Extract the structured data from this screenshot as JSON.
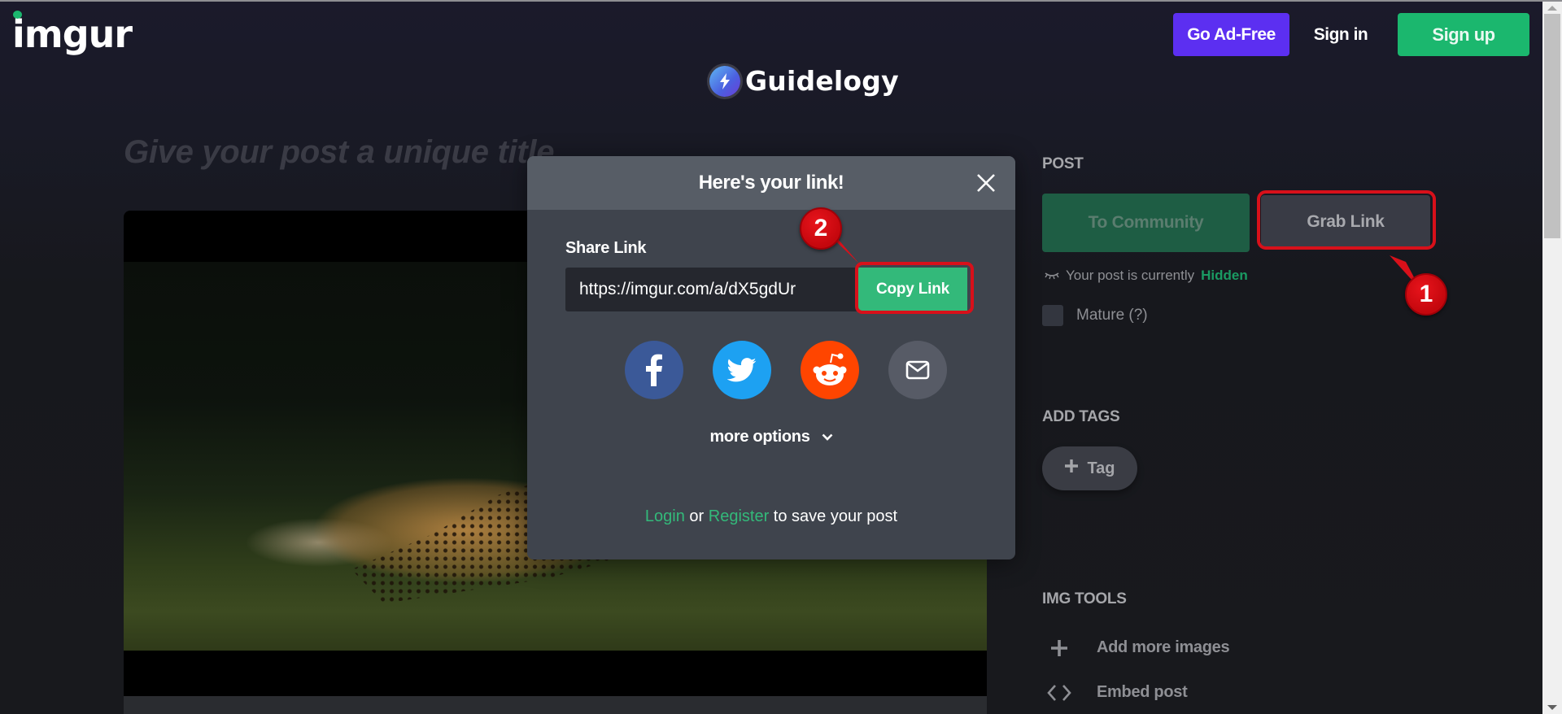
{
  "header": {
    "logo": "imgur",
    "go_ad_free": "Go Ad-Free",
    "sign_in": "Sign in",
    "sign_up": "Sign up",
    "watermark": "Guidelogy"
  },
  "post": {
    "title_placeholder": "Give your post a unique title",
    "title_value": ""
  },
  "modal": {
    "title": "Here's your link!",
    "share_label": "Share Link",
    "share_url": "https://imgur.com/a/dX5gdUr",
    "copy_button": "Copy Link",
    "share_targets": [
      {
        "name": "facebook",
        "icon": "facebook-icon",
        "color": "#3b5998"
      },
      {
        "name": "twitter",
        "icon": "twitter-icon",
        "color": "#1da1f2"
      },
      {
        "name": "reddit",
        "icon": "reddit-icon",
        "color": "#ff4500"
      },
      {
        "name": "email",
        "icon": "mail-icon",
        "color": "#575b66"
      }
    ],
    "more_options": "more options",
    "login_link": "Login",
    "or_text": "or",
    "register_link": "Register",
    "save_suffix": "to save your post"
  },
  "sidebar": {
    "post_label": "POST",
    "to_community": "To Community",
    "grab_link": "Grab Link",
    "visibility_prefix": "Your post is currently",
    "visibility_state": "Hidden",
    "mature_label": "Mature (?)",
    "mature_checked": false,
    "add_tags_label": "ADD TAGS",
    "tag_button": "Tag",
    "img_tools_label": "IMG TOOLS",
    "tools": [
      {
        "label": "Add more images",
        "icon": "plus-icon"
      },
      {
        "label": "Embed post",
        "icon": "code-brackets-icon"
      }
    ]
  },
  "annotations": {
    "step1": "1",
    "step2": "2"
  },
  "colors": {
    "imgur_green": "#1bb76e",
    "ad_free_purple": "#5c2ff1",
    "highlight_red": "#d8101a",
    "link_green": "#33b97a"
  }
}
